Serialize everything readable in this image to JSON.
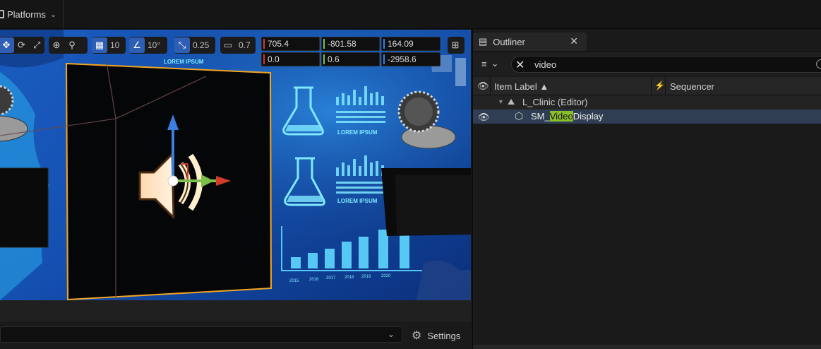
{
  "topbar": {
    "platforms_label": "Platforms",
    "platforms_icon": "monitor-icon"
  },
  "viewport": {
    "toolbar": {
      "snap_grid_value": "10",
      "snap_rotate_value": "10°",
      "snap_scale_value": "0.25",
      "camera_speed_value": "0.7"
    },
    "transform": {
      "location": [
        "705.4",
        "-801.58",
        "164.09"
      ],
      "rotation": [
        "0.0",
        "0.6",
        "-2958.6"
      ]
    },
    "scene_text": {
      "lorem": "LOREM IPSUM",
      "years": [
        "2015",
        "2016",
        "2017",
        "2018",
        "2019",
        "2020"
      ]
    }
  },
  "bottombar": {
    "settings_label": "Settings"
  },
  "outliner": {
    "tab_label": "Outliner",
    "search_value": "video",
    "columns": {
      "item_label": "Item Label ▲",
      "sequencer": "Sequencer"
    },
    "rows": [
      {
        "label": "L_Clinic (Editor)"
      },
      {
        "label_prefix": "SM_",
        "label_match": "Video",
        "label_suffix": "Display"
      }
    ]
  },
  "colors": {
    "accent_x": "#d63a2a",
    "accent_y": "#7cc04b",
    "accent_z": "#3b7fe0",
    "selection_outline": "#f2a623",
    "search_highlight": "#8bbf2a"
  }
}
